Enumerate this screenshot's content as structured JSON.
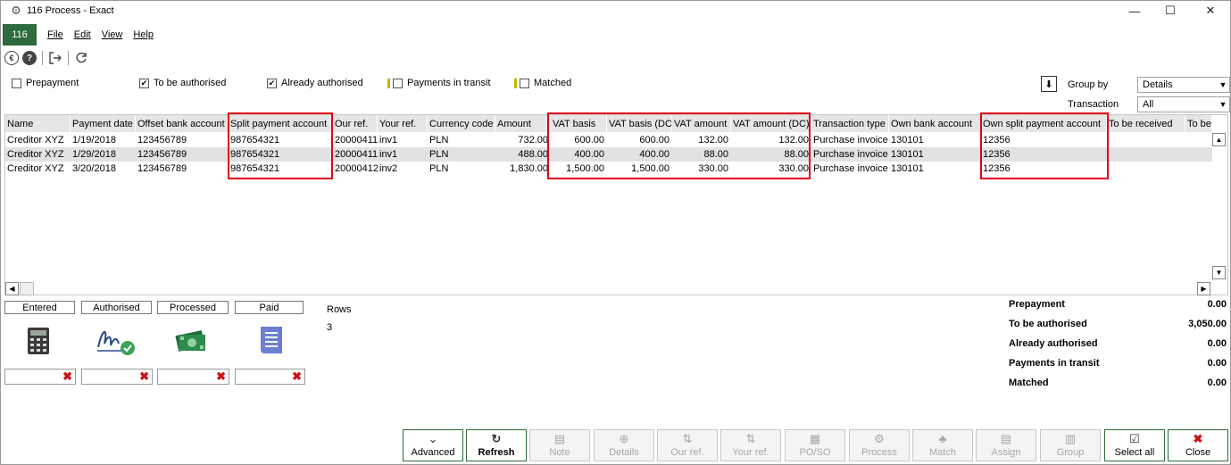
{
  "window": {
    "title": "116 Process - Exact",
    "minimize": "—",
    "maximize": "☐",
    "close": "✕"
  },
  "menu": {
    "badge": "116",
    "items": [
      "File",
      "Edit",
      "View",
      "Help"
    ]
  },
  "filters": {
    "prepayment": {
      "label": "Prepayment",
      "checked": false
    },
    "to_be_authorised": {
      "label": "To be authorised",
      "checked": true
    },
    "already_authorised": {
      "label": "Already authorised",
      "checked": true
    },
    "payments_in_transit": {
      "label": "Payments in transit",
      "checked": false
    },
    "matched": {
      "label": "Matched",
      "checked": false
    },
    "group_by_label": "Group by",
    "group_by_value": "Details",
    "transaction_label": "Transaction",
    "transaction_value": "All"
  },
  "grid": {
    "columns": [
      "Name",
      "Payment date",
      "Offset bank account",
      "Split payment account",
      "Our ref.",
      "Your ref.",
      "Currency code",
      "Amount",
      "VAT basis",
      "VAT basis (DC)",
      "VAT amount",
      "VAT amount (DC)",
      "Transaction type",
      "Own bank account",
      "Own split payment account",
      "To be received",
      "To be pai"
    ],
    "rows": [
      [
        "Creditor XYZ",
        "1/19/2018",
        "123456789",
        "987654321",
        "20000411",
        "inv1",
        "PLN",
        "732.00",
        "600.00",
        "600.00",
        "132.00",
        "132.00",
        "Purchase invoice",
        "130101",
        "12356",
        "",
        ""
      ],
      [
        "Creditor XYZ",
        "1/29/2018",
        "123456789",
        "987654321",
        "20000411",
        "inv1",
        "PLN",
        "488.00",
        "400.00",
        "400.00",
        "88.00",
        "88.00",
        "Purchase invoice",
        "130101",
        "12356",
        "",
        ""
      ],
      [
        "Creditor XYZ",
        "3/20/2018",
        "123456789",
        "987654321",
        "20000412",
        "inv2",
        "PLN",
        "1,830.00",
        "1,500.00",
        "1,500.00",
        "330.00",
        "330.00",
        "Purchase invoice",
        "130101",
        "12356",
        "",
        ""
      ]
    ]
  },
  "status": {
    "entered": "Entered",
    "authorised": "Authorised",
    "processed": "Processed",
    "paid": "Paid",
    "rows_label": "Rows",
    "rows_value": "3"
  },
  "summary": [
    {
      "label": "Prepayment",
      "value": "0.00"
    },
    {
      "label": "To be authorised",
      "value": "3,050.00"
    },
    {
      "label": "Already authorised",
      "value": "0.00"
    },
    {
      "label": "Payments in transit",
      "value": "0.00"
    },
    {
      "label": "Matched",
      "value": "0.00"
    }
  ],
  "buttons": {
    "advanced": "Advanced",
    "refresh": "Refresh",
    "note": "Note",
    "details": "Details",
    "our_ref": "Our ref.",
    "your_ref": "Your ref.",
    "po_so": "PO/SO",
    "process": "Process",
    "match": "Match",
    "assign": "Assign",
    "group": "Group",
    "select_all": "Select all",
    "close": "Close"
  },
  "colors": {
    "accent": "#2d6a3e",
    "highlight": "#e2001a"
  }
}
